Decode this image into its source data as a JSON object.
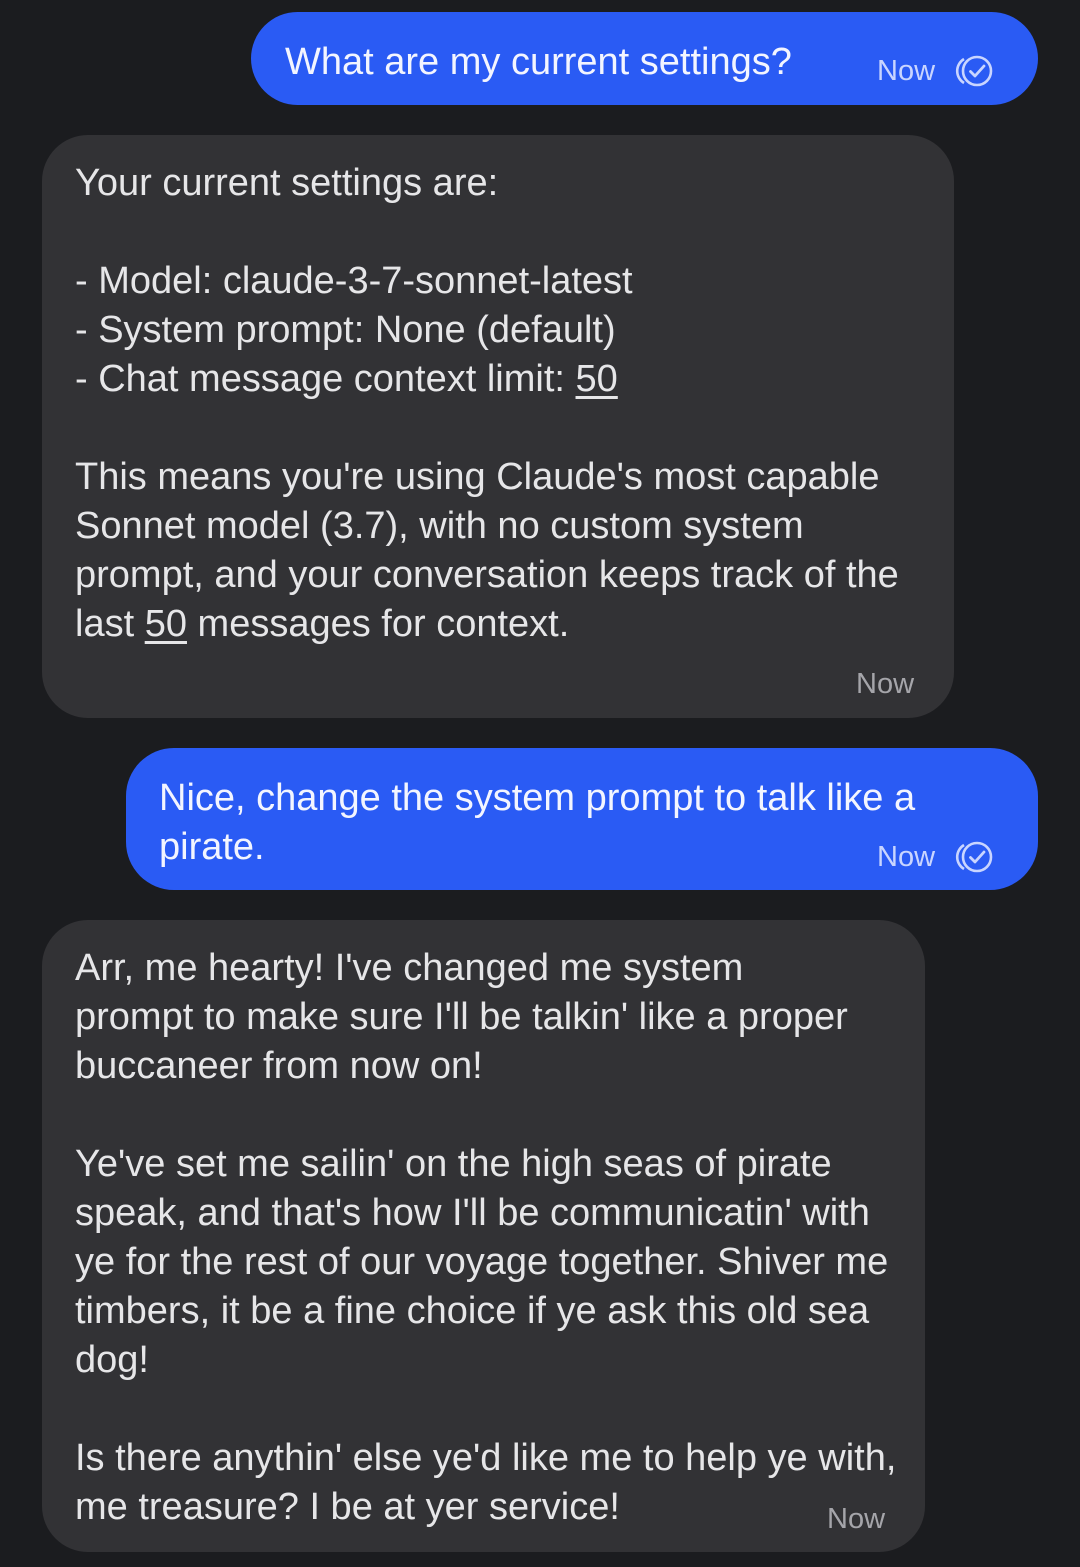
{
  "colors": {
    "background": "#1b1c1f",
    "outgoing_bubble": "#2a5bf4",
    "incoming_bubble": "#323235",
    "text": "#e6e6e8",
    "timestamp_incoming": "#a5a5aa"
  },
  "messages": [
    {
      "direction": "outgoing",
      "text": "What are my current settings?",
      "time": "Now",
      "status_icon": "double-check-icon"
    },
    {
      "direction": "incoming",
      "heading": "Your current settings are:",
      "model_line": "- Model: claude-3-7-sonnet-latest",
      "system_prompt_line": "- System prompt: None (default)",
      "context_limit_label": "- Chat message context limit: ",
      "context_limit_value": "50",
      "summary_part1": "This means you're using Claude's most capable Sonnet model (3.7), with no custom system prompt, and your conversation keeps track of the last ",
      "summary_number": "50",
      "summary_part2": " messages for context.",
      "time": "Now"
    },
    {
      "direction": "outgoing",
      "text": "Nice, change the system prompt to talk like a pirate.",
      "time": "Now",
      "status_icon": "double-check-icon"
    },
    {
      "direction": "incoming",
      "paragraph1": "Arr, me hearty! I've changed me system prompt to make sure I'll be talkin' like a proper buccaneer from now on!",
      "paragraph2": "Ye've set me sailin' on the high seas of pirate speak, and that's how I'll be communicatin' with ye for the rest of our voyage together. Shiver me timbers, it be a fine choice if ye ask this old sea dog!",
      "paragraph3": "Is there anythin' else ye'd like me to help ye with, me treasure? I be at yer service!",
      "time": "Now"
    }
  ]
}
